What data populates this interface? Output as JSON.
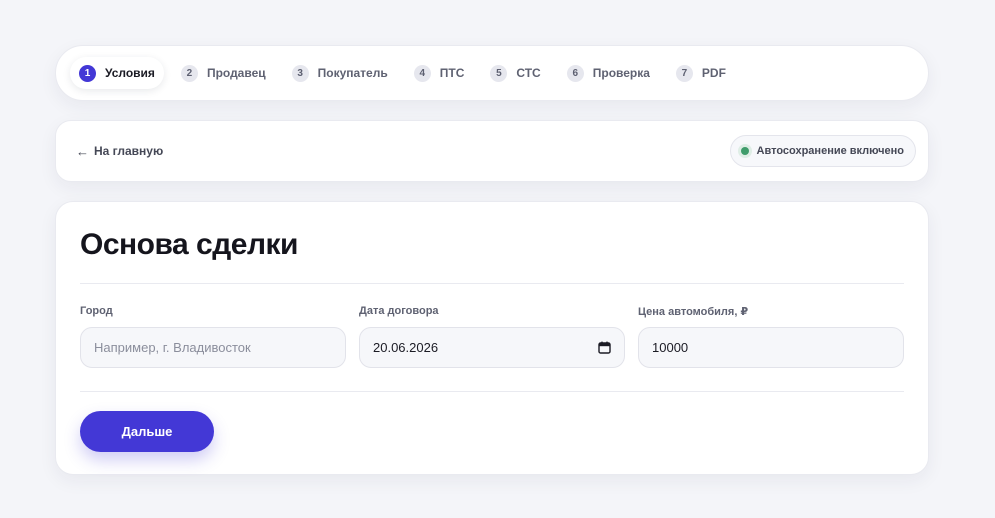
{
  "stepper": {
    "steps": [
      {
        "num": "1",
        "label": "Условия"
      },
      {
        "num": "2",
        "label": "Продавец"
      },
      {
        "num": "3",
        "label": "Покупатель"
      },
      {
        "num": "4",
        "label": "ПТС"
      },
      {
        "num": "5",
        "label": "СТС"
      },
      {
        "num": "6",
        "label": "Проверка"
      },
      {
        "num": "7",
        "label": "PDF"
      }
    ],
    "active_index": 0
  },
  "nav": {
    "back_arrow": "←",
    "back_label": "На главную",
    "autosave_label": "Автосохранение включено",
    "autosave_color": "#3f9c6b"
  },
  "form": {
    "title": "Основа сделки",
    "city": {
      "label": "Город",
      "value": "",
      "placeholder": "Например, г. Владивосток"
    },
    "date": {
      "label": "Дата договора",
      "value": "20.06.2026",
      "icon": "calendar-icon"
    },
    "price": {
      "label": "Цена автомобиля, ₽",
      "value": "10000"
    },
    "next_label": "Дальше"
  },
  "colors": {
    "accent": "#4338d6",
    "background": "#f4f5f9"
  }
}
